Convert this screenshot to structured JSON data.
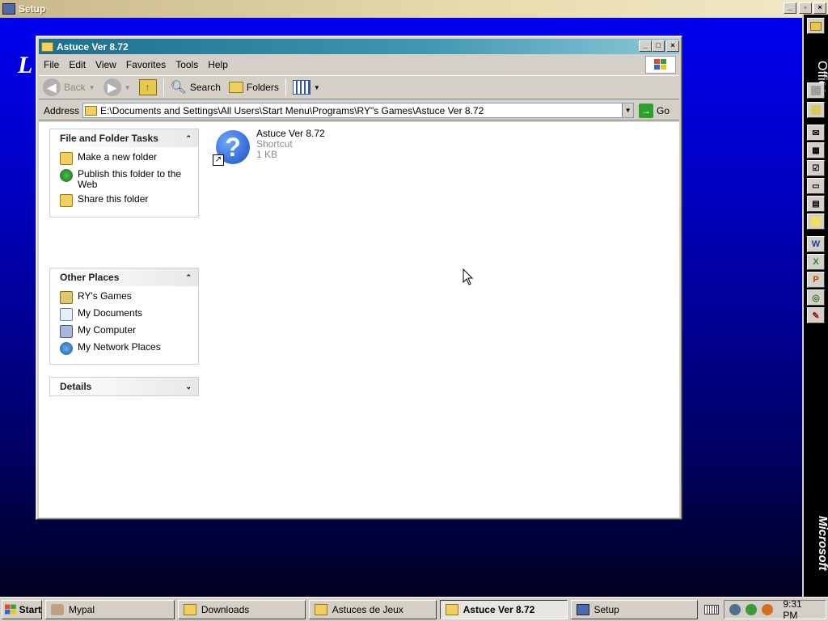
{
  "setup": {
    "title": "Setup",
    "letter": "L"
  },
  "office_bar": {
    "label": "Office",
    "footer": "Microsoft",
    "buttons": [
      "office-app-1",
      "office-app-2",
      "outlook",
      "calendar",
      "tasks",
      "contacts",
      "journal",
      "notes",
      "word",
      "excel",
      "powerpoint",
      "publisher",
      "access"
    ]
  },
  "explorer": {
    "title": "Astuce Ver 8.72",
    "menu": [
      "File",
      "Edit",
      "View",
      "Favorites",
      "Tools",
      "Help"
    ],
    "toolbar": {
      "back": "Back",
      "search": "Search",
      "folders": "Folders"
    },
    "address": {
      "label": "Address",
      "value": "E:\\Documents and Settings\\All Users\\Start Menu\\Programs\\RY\"s Games\\Astuce Ver 8.72",
      "go": "Go"
    },
    "file_tasks": {
      "title": "File and Folder Tasks",
      "items": [
        "Make a new folder",
        "Publish this folder to the Web",
        "Share this folder"
      ]
    },
    "other_places": {
      "title": "Other Places",
      "items": [
        "RY's Games",
        "My Documents",
        "My Computer",
        "My Network Places"
      ]
    },
    "details": {
      "title": "Details"
    },
    "file": {
      "name": "Astuce Ver 8.72",
      "type": "Shortcut",
      "size": "1 KB"
    }
  },
  "taskbar": {
    "start": "Start",
    "buttons": [
      "Mypal",
      "Downloads",
      "Astuces de Jeux",
      "Astuce Ver 8.72",
      "Setup"
    ],
    "active": "Astuce Ver 8.72",
    "clock": "9:31 PM"
  }
}
